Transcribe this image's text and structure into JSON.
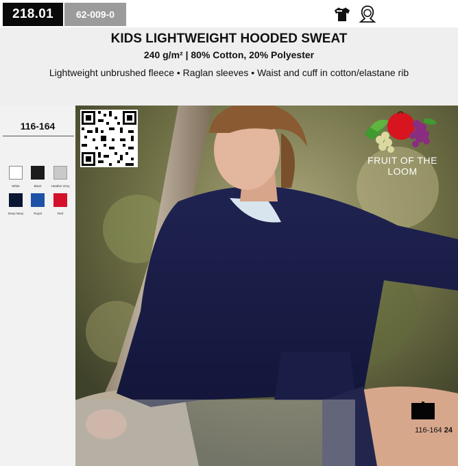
{
  "codes": {
    "main": "218.01",
    "secondary": "62-009-0"
  },
  "icons": {
    "tshirt": "tshirt-icon",
    "hood": "hood-icon"
  },
  "product": {
    "title": "KIDS LIGHTWEIGHT HOODED SWEAT",
    "subtitle": "240 g/m² | 80% Cotton, 20% Polyester",
    "features": "Lightweight unbrushed fleece • Raglan sleeves • Waist and cuff in cotton/elastane rib"
  },
  "sizes": "116-164",
  "colors": [
    {
      "name": "White",
      "hex": "#ffffff"
    },
    {
      "name": "Black",
      "hex": "#1c1c1c"
    },
    {
      "name": "Heather Grey",
      "hex": "#c9c9c9"
    },
    {
      "name": "Deep Navy",
      "hex": "#0b1633"
    },
    {
      "name": "Royal",
      "hex": "#1d52a8"
    },
    {
      "name": "Red",
      "hex": "#d4102a"
    }
  ],
  "brand": {
    "name": "FRUIT OF THE LOOM"
  },
  "packaging": {
    "sizes": "116-164",
    "quantity": "24"
  }
}
